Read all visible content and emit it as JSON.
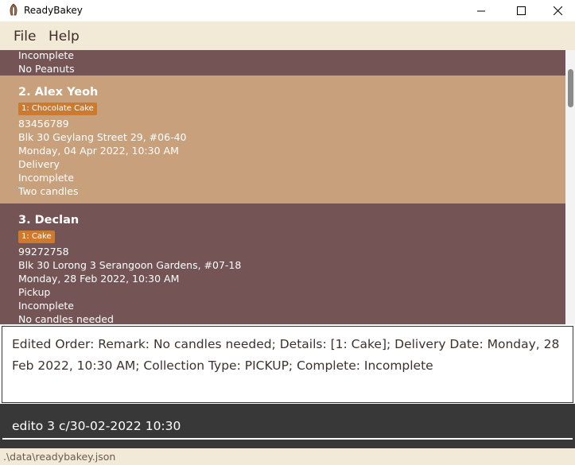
{
  "window": {
    "title": "ReadyBakey",
    "icon": "readybakey-app-icon",
    "controls": [
      "minimize-icon",
      "maximize-icon",
      "close-icon"
    ]
  },
  "menu": {
    "file": "File",
    "help": "Help"
  },
  "orders": [
    {
      "lines": [
        "Incomplete",
        "No Peanuts"
      ]
    },
    {
      "index_name": "2.  Alex Yeoh",
      "tag": "1: Chocolate Cake",
      "phone": "83456789",
      "address": "Blk 30 Geylang Street 29, #06-40",
      "date": "Monday, 04 Apr 2022, 10:30 AM",
      "collection": "Delivery",
      "status": "Incomplete",
      "remark": "Two candles"
    },
    {
      "index_name": "3.  Declan",
      "tag": "1: Cake",
      "phone": "99272758",
      "address": "Blk 30 Lorong 3 Serangoon Gardens, #07-18",
      "date": "Monday, 28 Feb 2022, 10:30 AM",
      "collection": "Pickup",
      "status": "Incomplete",
      "remark": "No candles needed"
    }
  ],
  "result": {
    "message": "Edited Order: Remark: No candles needed; Details: [1: Cake]; Delivery Date: Monday, 28 Feb 2022, 10:30 AM; Collection Type: PICKUP; Complete: Incomplete"
  },
  "command": {
    "value": "edito 3 c/30-02-2022 10:30"
  },
  "status": {
    "path": ".\\data\\readybakey.json"
  },
  "colors": {
    "list_bg": "#745454",
    "selected_card_bg": "#c8a07c",
    "tag_bg": "#cc7a30",
    "menubar_bg": "#f3e9d7",
    "command_bg": "#383838"
  }
}
